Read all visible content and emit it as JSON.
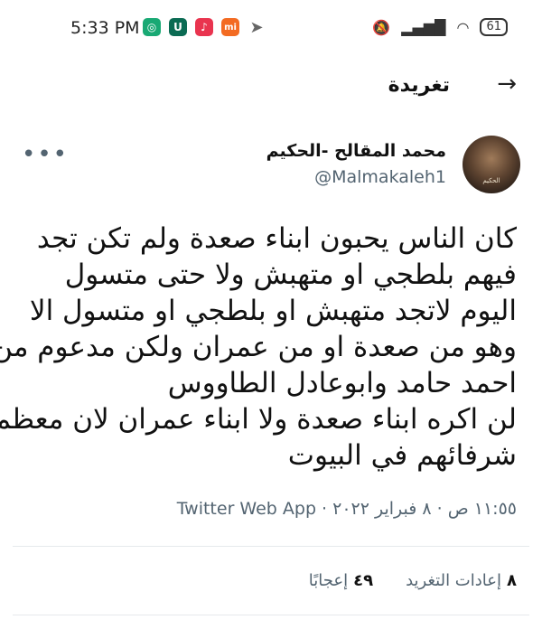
{
  "status_bar": {
    "time": "5:33 PM",
    "battery": "61",
    "app_icons": [
      "messages-icon",
      "shield-app-icon",
      "tiktok-icon",
      "mi-icon",
      "telegram-icon"
    ],
    "right_icons": [
      "mute-icon",
      "signal-icon",
      "wifi-icon",
      "battery-icon"
    ]
  },
  "header": {
    "title": "تغريدة",
    "back_icon": "arrow-icon"
  },
  "author": {
    "name": "محمد المقالح -الحكيم",
    "handle": "@Malmakaleh1",
    "avatar_caption": "الحكيم"
  },
  "tweet": {
    "lines": [
      "كان الناس يحبون ابناء صعدة ولم تكن تجد",
      "فيهم بلطجي او متهبش ولا حتى متسول",
      "اليوم  لاتجد متهبش او بلطجي او متسول الا",
      "وهو من صعدة او من عمران ولكن مدعوم من",
      "احمد حامد وابوعادل الطاووس",
      "لن اكره ابناء صعدة ولا ابناء عمران لان معظم",
      "شرفائهم في البيوت"
    ],
    "meta": "١١:٥٥ ص · ٨ فبراير ٢٠٢٢ · Twitter Web App"
  },
  "stats": {
    "retweets_count": "٨",
    "retweets_label": "إعادات التغريد",
    "likes_count": "٤٩",
    "likes_label": "إعجابًا"
  },
  "colors": {
    "text": "#0f1419",
    "secondary": "#536471",
    "divider": "#e6e9ec"
  }
}
